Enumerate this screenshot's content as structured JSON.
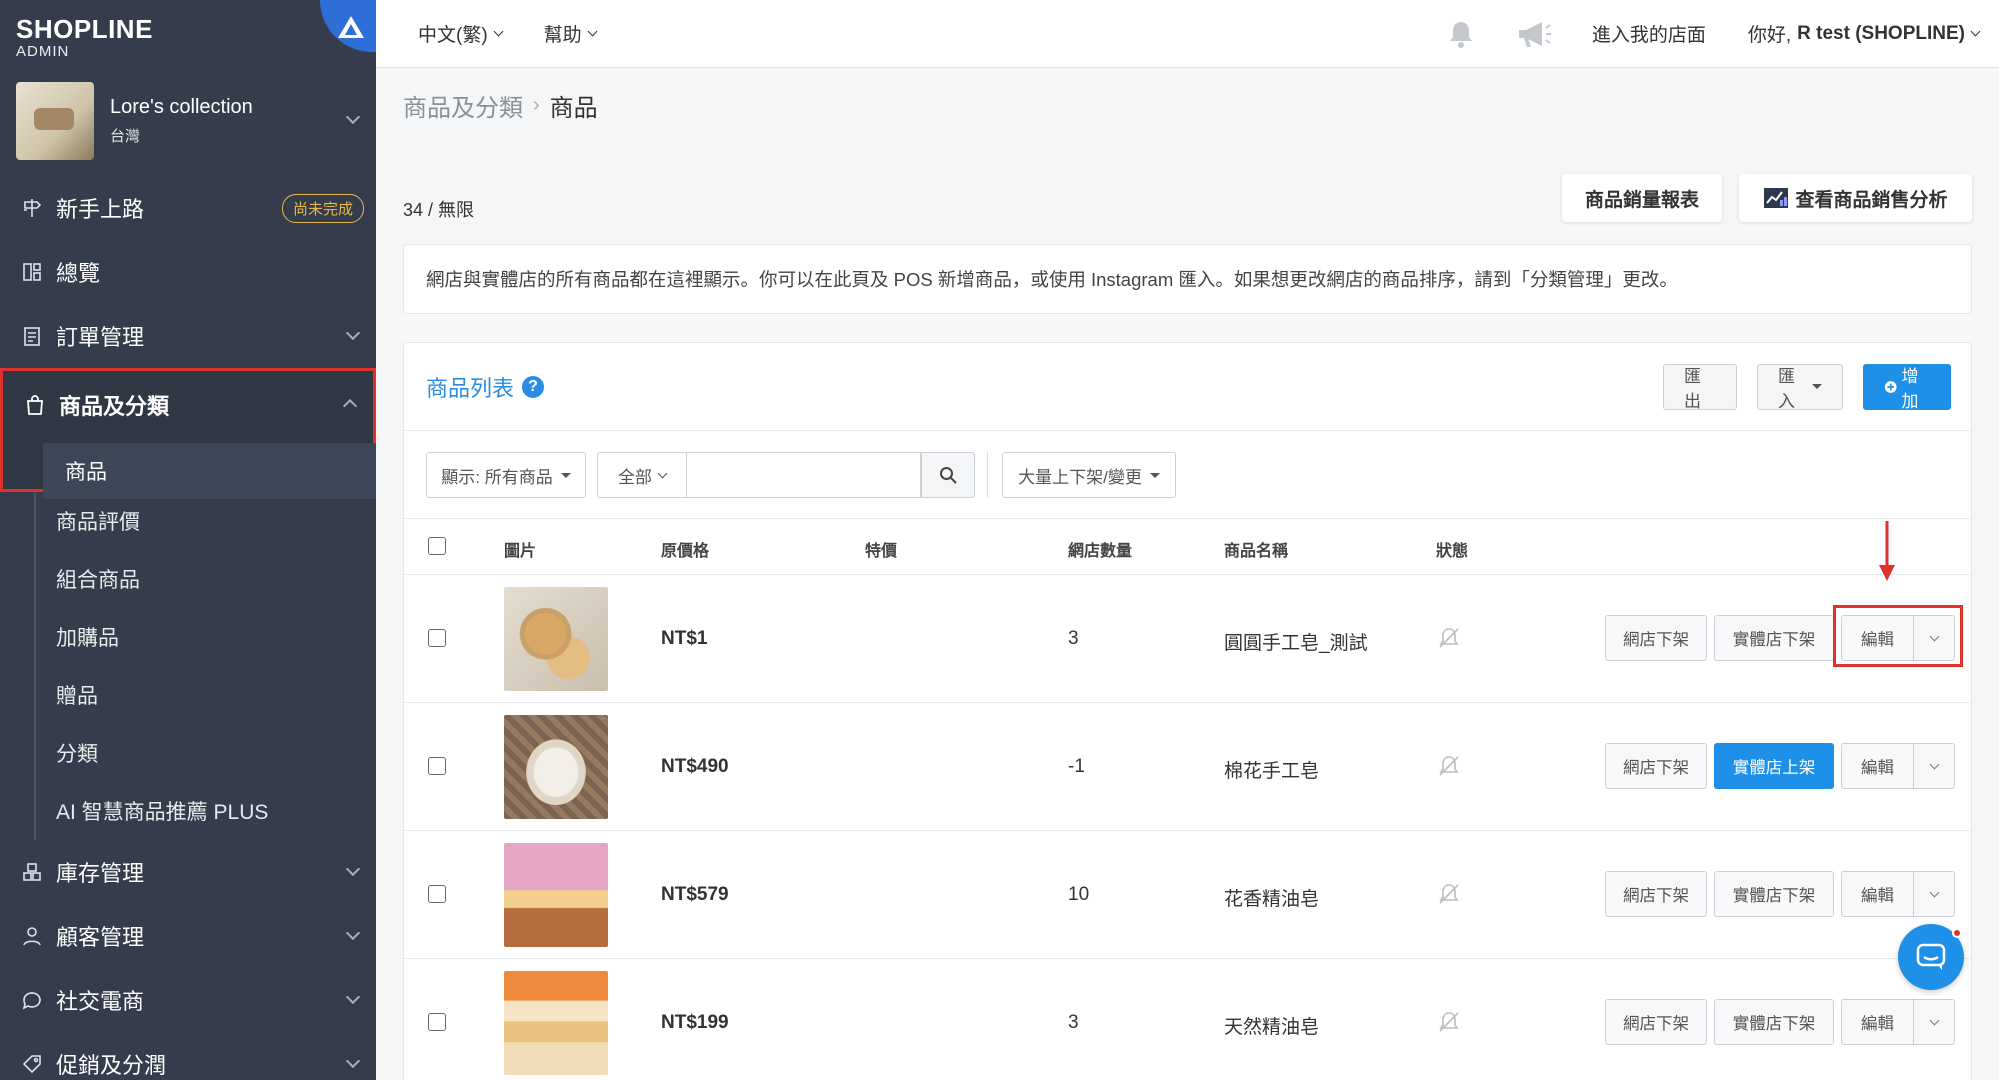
{
  "brand": {
    "logo": "SHOPLINE",
    "sub": "ADMIN"
  },
  "store": {
    "name": "Lore's collection",
    "region": "台灣"
  },
  "sidebar": {
    "items": [
      {
        "label": "新手上路",
        "badge": "尚未完成"
      },
      {
        "label": "總覽"
      },
      {
        "label": "訂單管理"
      },
      {
        "label": "商品及分類"
      },
      {
        "label": "庫存管理"
      },
      {
        "label": "顧客管理"
      },
      {
        "label": "社交電商"
      },
      {
        "label": "促銷及分潤"
      }
    ],
    "active_sub": "商品",
    "subs": [
      "商品評價",
      "組合商品",
      "加購品",
      "贈品",
      "分類",
      "AI 智慧商品推薦 PLUS"
    ]
  },
  "topbar": {
    "lang": "中文(繁)",
    "help": "幫助",
    "shop": "進入我的店面",
    "greeting": "你好,",
    "user": "R test (SHOPLINE)"
  },
  "breadcrumb": {
    "parent": "商品及分類",
    "sep": "›",
    "current": "商品"
  },
  "count": "34 / 無限",
  "buttons": {
    "sales_report": "商品銷量報表",
    "sales_analysis": "查看商品銷售分析"
  },
  "notice": "網店與實體店的所有商品都在這裡顯示。你可以在此頁及 POS 新增商品，或使用 Instagram 匯入。如果想更改網店的商品排序，請到「分類管理」更改。",
  "panel": {
    "title": "商品列表",
    "help": "?",
    "export": "匯出",
    "import": "匯入",
    "add": "增加"
  },
  "filters": {
    "display": "顯示: 所有商品",
    "scope": "全部",
    "search_placeholder": "",
    "bulk": "大量上下架/變更"
  },
  "table": {
    "headers": [
      "圖片",
      "原價格",
      "特價",
      "網店數量",
      "商品名稱",
      "狀態"
    ],
    "rows": [
      {
        "price": "NT$1",
        "qty": "3",
        "name": "圓圓手工皂_測試",
        "online": "網店下架",
        "pos": "實體店下架",
        "pos_active": false,
        "edit": "編輯"
      },
      {
        "price": "NT$490",
        "qty": "-1",
        "name": "棉花手工皂",
        "online": "網店下架",
        "pos": "實體店上架",
        "pos_active": true,
        "edit": "編輯"
      },
      {
        "price": "NT$579",
        "qty": "10",
        "name": "花香精油皂",
        "online": "網店下架",
        "pos": "實體店下架",
        "pos_active": false,
        "edit": "編輯"
      },
      {
        "price": "NT$199",
        "qty": "3",
        "name": "天然精油皂",
        "online": "網店下架",
        "pos": "實體店下架",
        "pos_active": false,
        "edit": "編輯"
      }
    ]
  },
  "colors": {
    "sidebar": "#353d4d",
    "accent": "#1e90e8",
    "highlight": "#e0322d",
    "badge": "#e6b84b"
  },
  "icons": [
    "bell-icon",
    "megaphone-icon",
    "search-icon",
    "muted-bell-icon",
    "chat-icon",
    "chart-icon"
  ]
}
